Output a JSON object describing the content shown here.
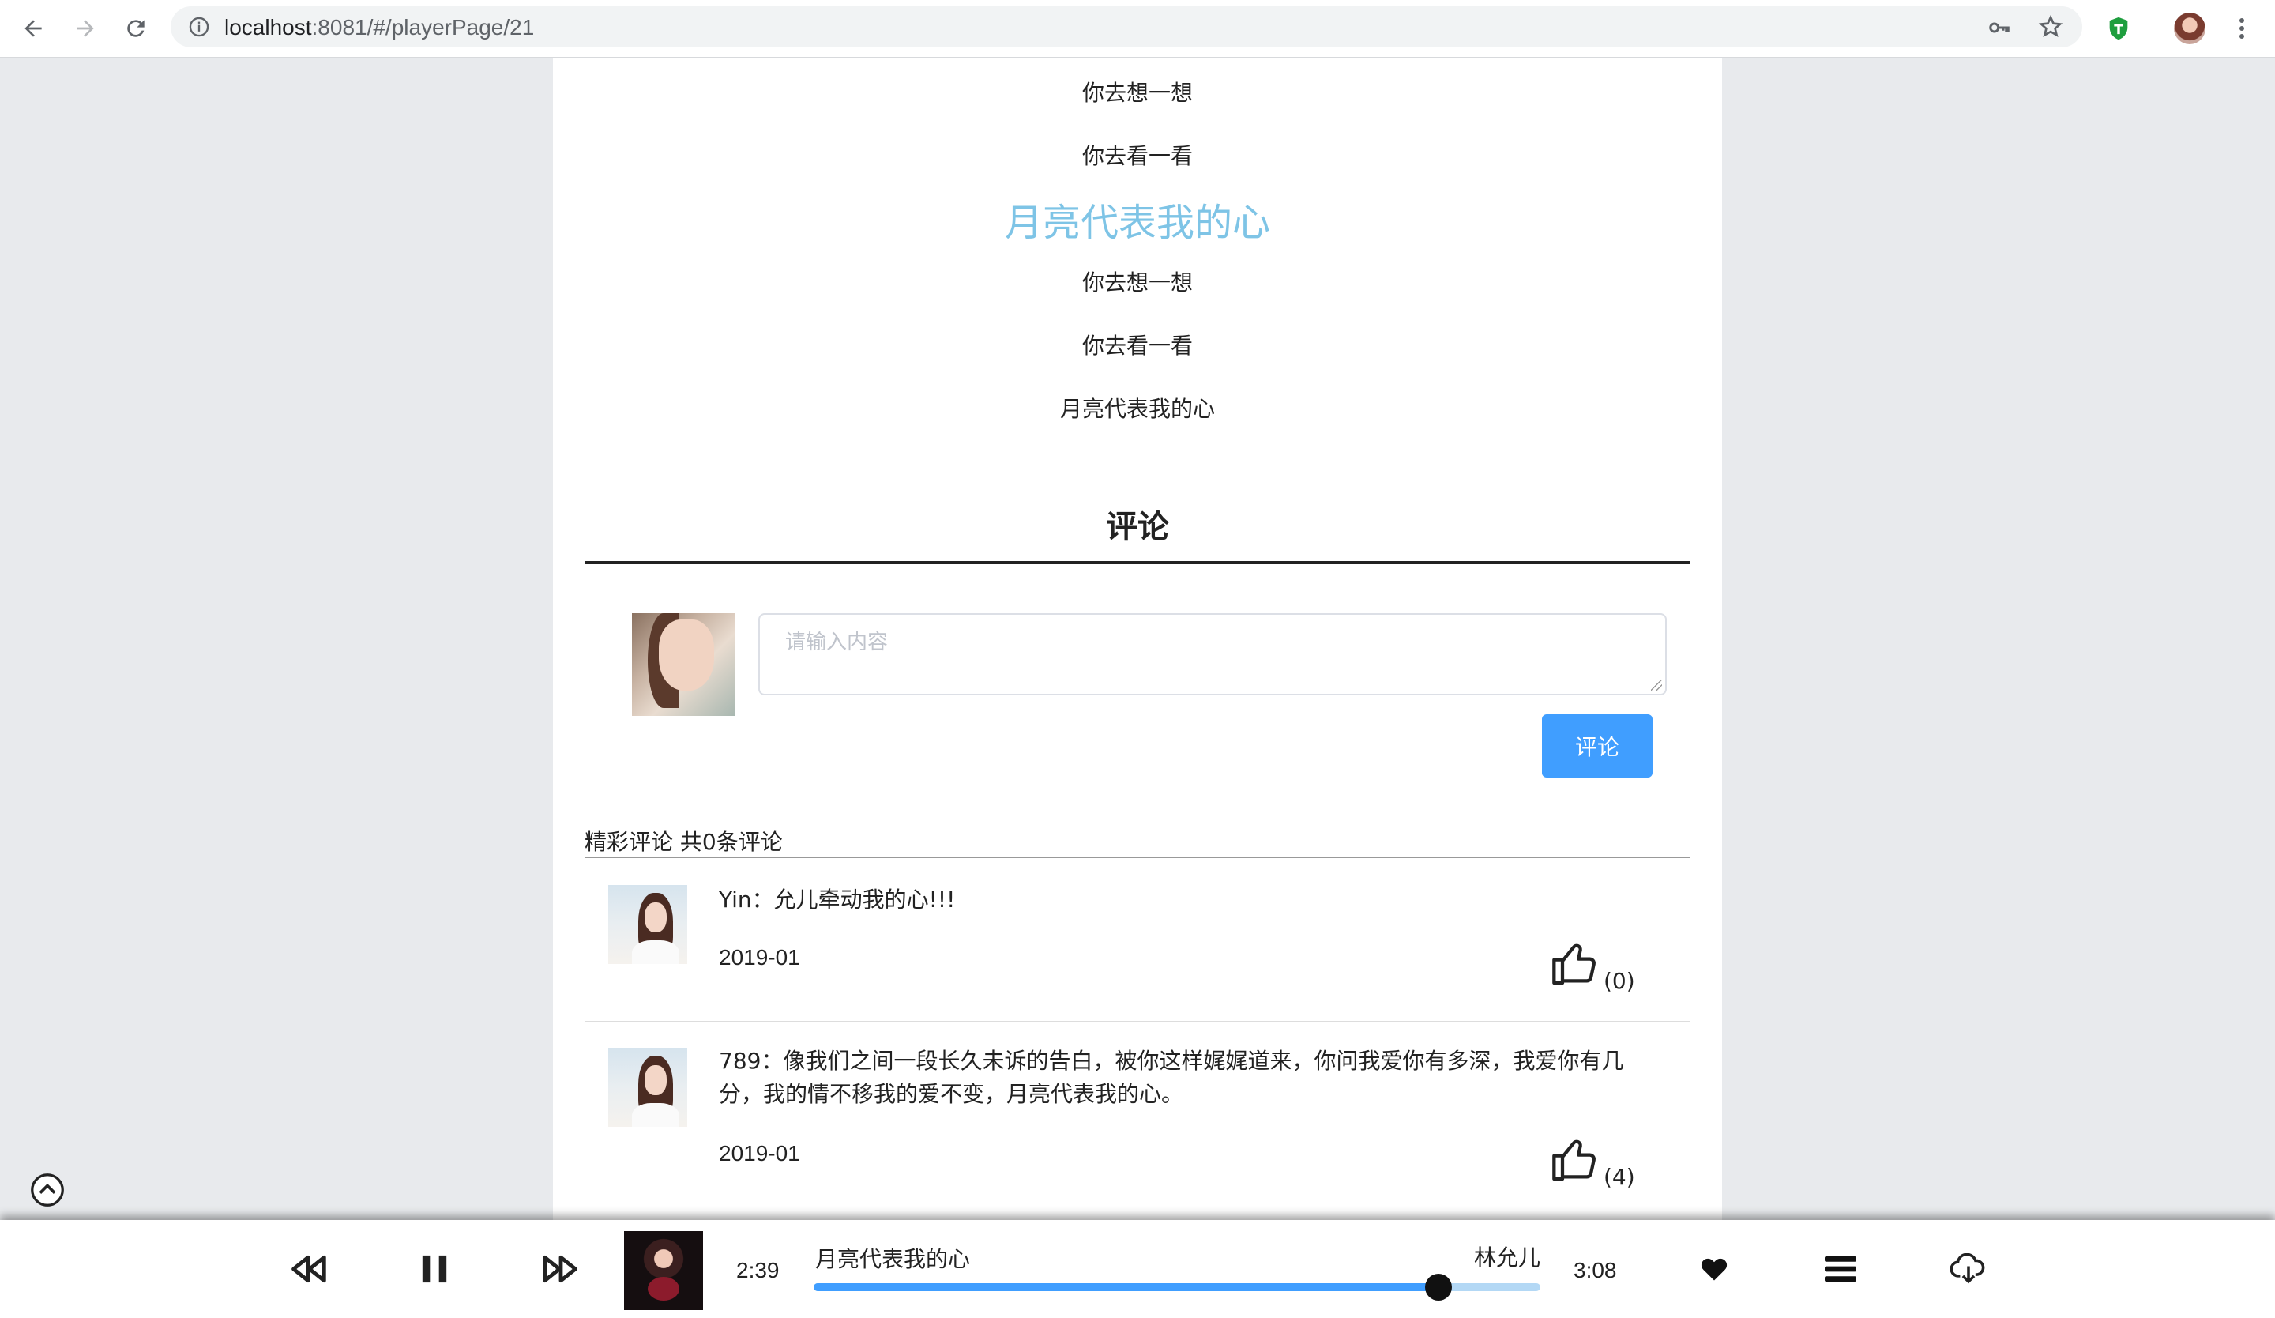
{
  "browser": {
    "url_host": "localhost",
    "url_rest": ":8081/#/playerPage/21"
  },
  "lyrics": [
    {
      "text": "你去想一想",
      "active": false
    },
    {
      "text": "你去看一看",
      "active": false
    },
    {
      "text": "月亮代表我的心",
      "active": true
    },
    {
      "text": "你去想一想",
      "active": false
    },
    {
      "text": "你去看一看",
      "active": false
    },
    {
      "text": "月亮代表我的心",
      "active": false
    }
  ],
  "comments_section": {
    "title": "评论",
    "input_placeholder": "请输入内容",
    "submit_label": "评论",
    "hot_label": "精彩评论 共0条评论"
  },
  "comments": [
    {
      "text": "Yin：允儿牵动我的心!!!",
      "date": "2019-01",
      "likes": "(0)"
    },
    {
      "text": "789：像我们之间一段长久未诉的告白，被你这样娓娓道来，你问我爱你有多深，我爱你有几分，我的情不移我的爱不变，月亮代表我的心。",
      "date": "2019-01",
      "likes": "(4)"
    }
  ],
  "player": {
    "elapsed": "2:39",
    "duration": "3:08",
    "song_title": "月亮代表我的心",
    "singer": "林允儿",
    "progress": 0.86
  },
  "colors": {
    "accent": "#409eff",
    "active_lyric": "#7ec4e6",
    "track": "#b3d8f5"
  }
}
